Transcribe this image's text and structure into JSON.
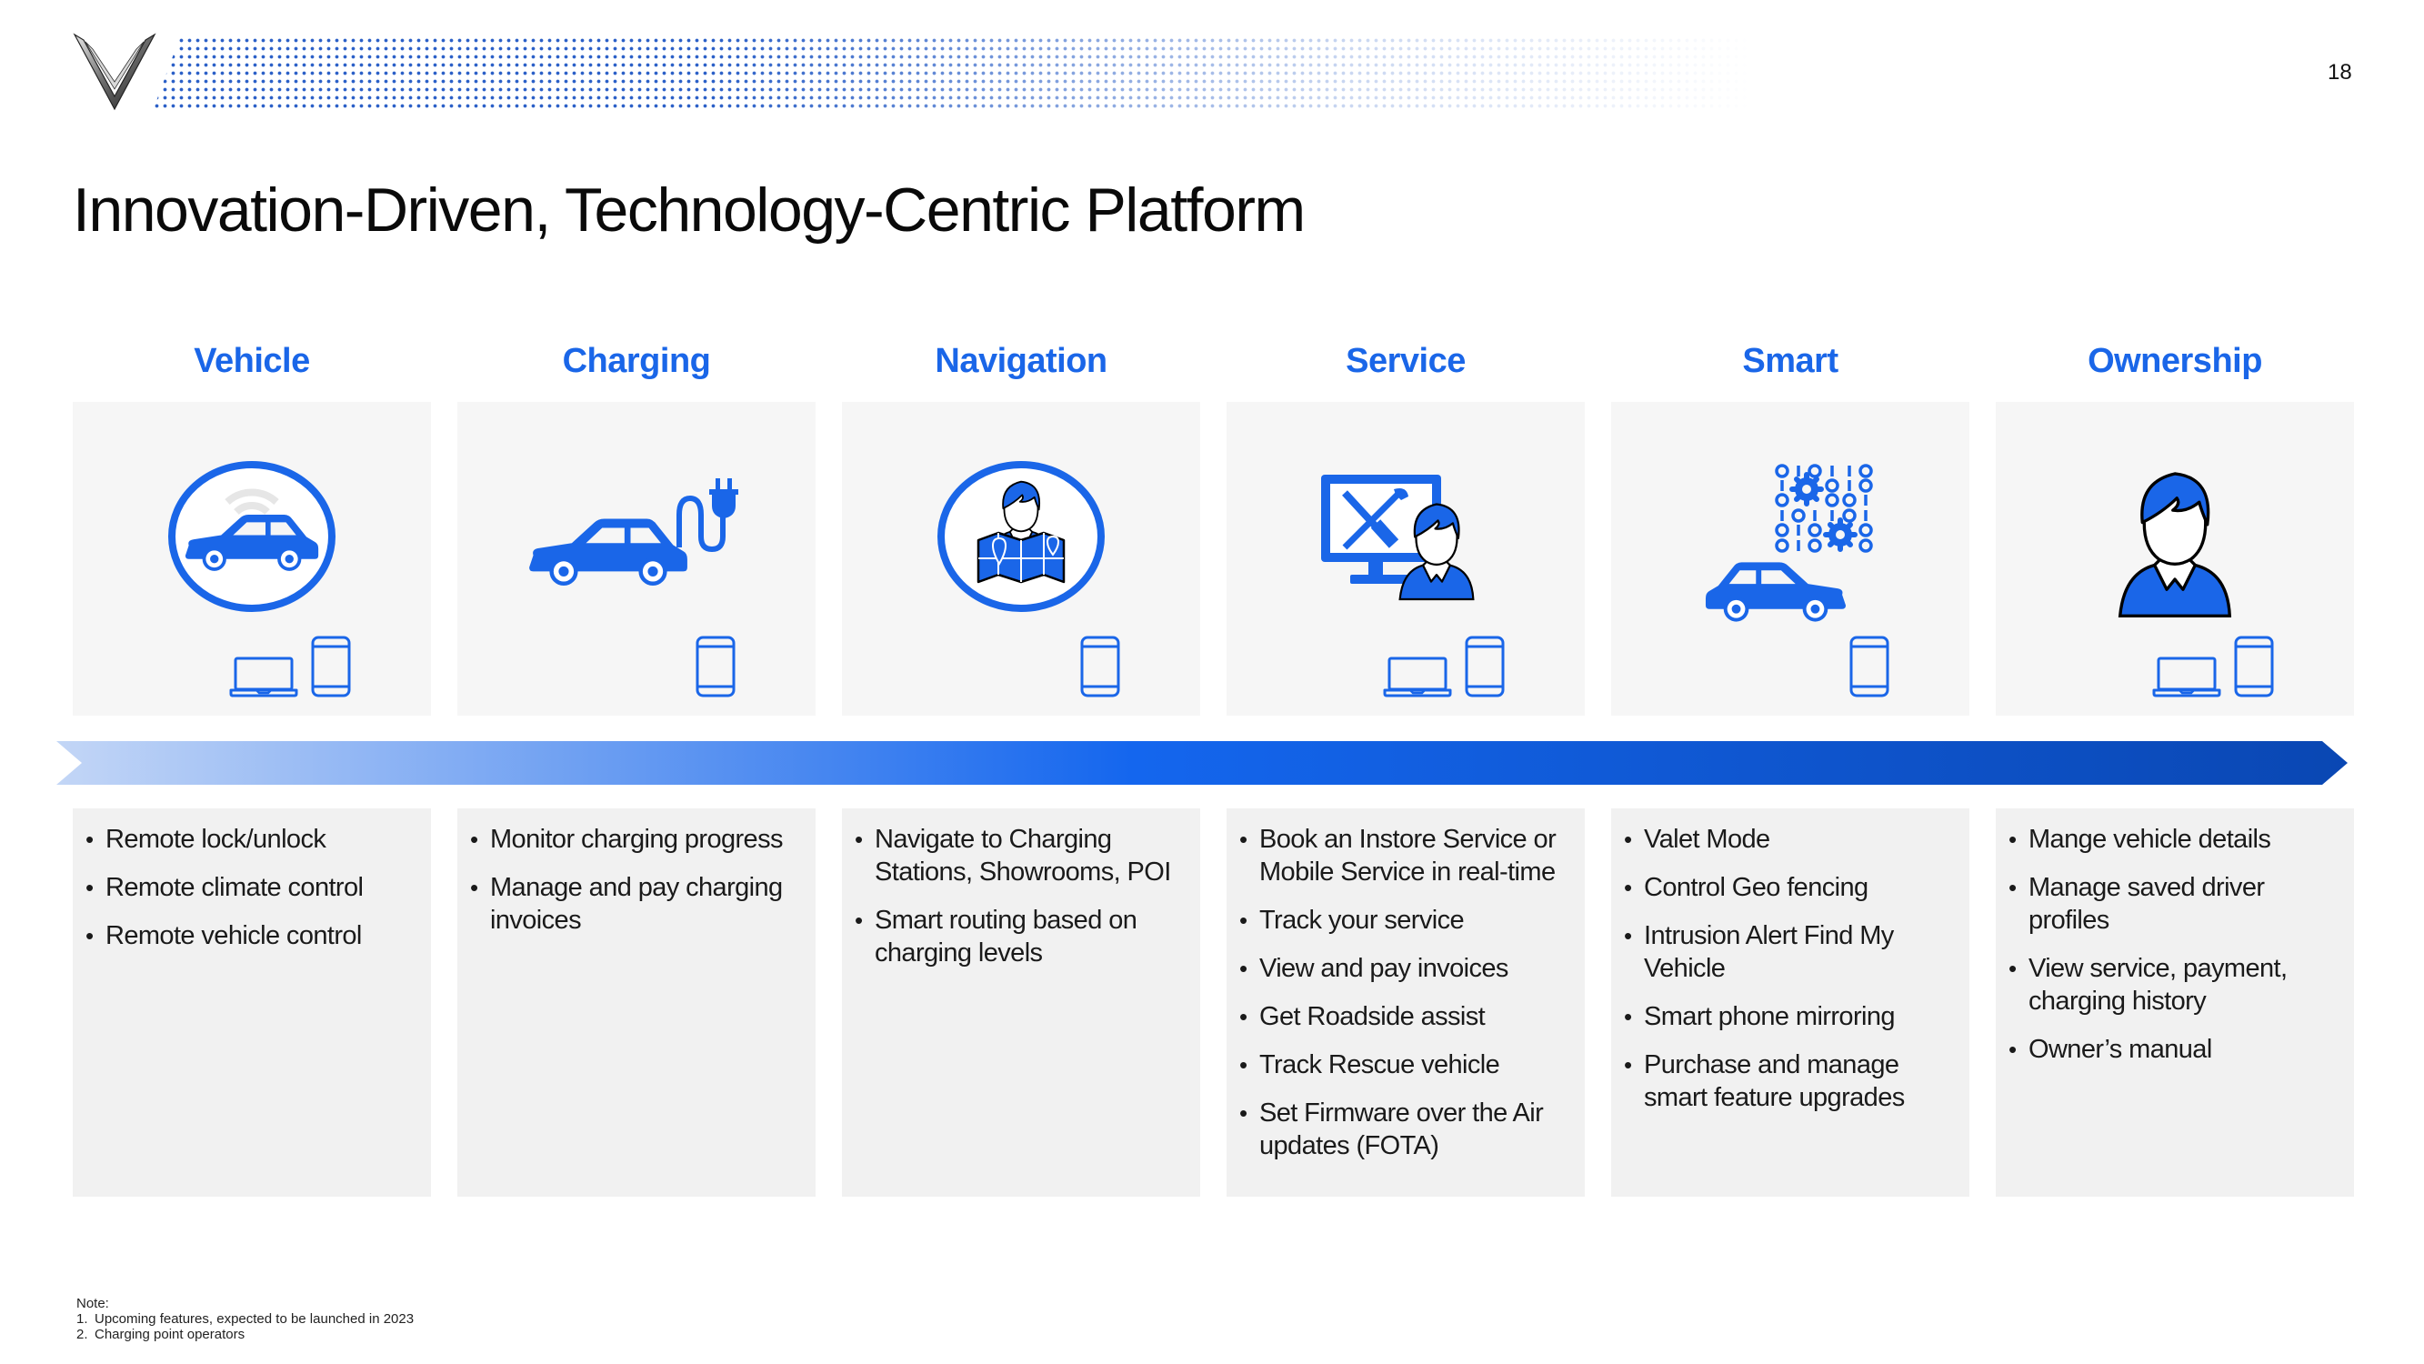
{
  "header": {
    "logo": "vinfast-v-logo",
    "page_number": "18",
    "title": "Innovation-Driven, Technology-Centric Platform"
  },
  "columns": [
    {
      "id": "vehicle",
      "label": "Vehicle",
      "icon": "car-in-circle-wifi-icon",
      "devices": [
        "laptop",
        "phone"
      ],
      "features": [
        "Remote lock/unlock",
        "Remote climate control",
        "Remote vehicle control"
      ]
    },
    {
      "id": "charging",
      "label": "Charging",
      "icon": "car-charging-plug-icon",
      "devices": [
        "phone"
      ],
      "features": [
        "Monitor charging progress",
        "Manage and pay charging invoices"
      ]
    },
    {
      "id": "navigation",
      "label": "Navigation",
      "icon": "person-with-map-icon",
      "devices": [
        "phone"
      ],
      "features": [
        "Navigate to Charging Stations, Showrooms, POI",
        "Smart routing based on charging levels"
      ]
    },
    {
      "id": "service",
      "label": "Service",
      "icon": "technician-monitor-tools-icon",
      "devices": [
        "laptop",
        "phone"
      ],
      "features": [
        "Book an Instore Service or Mobile Service in real-time",
        "Track your service",
        "View and pay invoices",
        "Get Roadside assist",
        "Track Rescue vehicle",
        "Set Firmware over the Air updates (FOTA)"
      ]
    },
    {
      "id": "smart",
      "label": "Smart",
      "icon": "car-binary-gears-icon",
      "devices": [
        "phone"
      ],
      "features": [
        "Valet Mode",
        "Control Geo fencing",
        "Intrusion Alert Find My Vehicle",
        "Smart phone mirroring",
        "Purchase and manage smart feature upgrades"
      ]
    },
    {
      "id": "ownership",
      "label": "Ownership",
      "icon": "person-avatar-icon",
      "devices": [
        "laptop",
        "phone"
      ],
      "features": [
        "Mange vehicle details",
        "Manage saved driver profiles",
        "View service, payment, charging history",
        "Owner’s manual"
      ]
    }
  ],
  "notes": {
    "heading": "Note:",
    "items": [
      {
        "num": "1.",
        "text": "Upcoming features, expected to be launched in 2023"
      },
      {
        "num": "2.",
        "text": "Charging point operators"
      }
    ]
  },
  "colors": {
    "accent": "#1a66e8",
    "card_top_bg": "#f6f6f6",
    "card_bottom_bg": "#f1f1f1",
    "arrow_start": "#c3d6f6",
    "arrow_mid": "#1466ee",
    "arrow_end": "#0a47b3"
  }
}
